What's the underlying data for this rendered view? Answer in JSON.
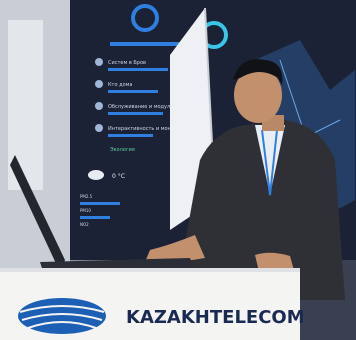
{
  "photo": {
    "booth_brand": "KAZAKHTELECOM",
    "screen_items": [
      "Систем в Бров",
      "Кто дома",
      "Обслуживание и модули",
      "Интерактивность и мониторинг"
    ],
    "screen_section": "Экология",
    "screen_temp": "0 °C",
    "screen_small_labels": [
      "PM2.5",
      "PM10",
      "NO2"
    ],
    "colors": {
      "screen_dark": "#1c2235",
      "accent_blue": "#2f7fe0",
      "accent_cyan": "#39c6e8",
      "counter_white": "#f4f4f2",
      "logo_blue": "#1d5fb4",
      "suit": "#2f3035"
    }
  }
}
